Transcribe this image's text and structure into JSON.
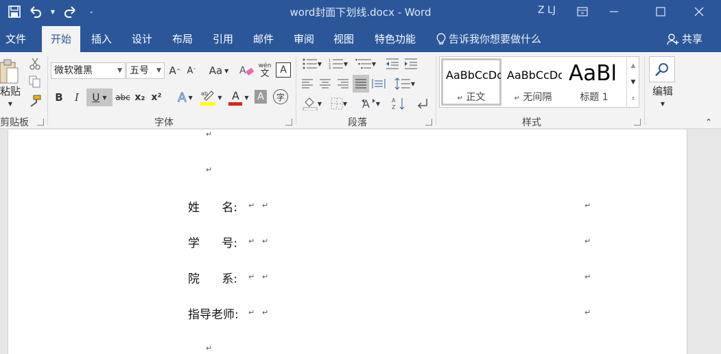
{
  "window": {
    "title": "word封面下划线.docx  -  Word",
    "user": "Z LJ"
  },
  "tabs": [
    "文件",
    "开始",
    "插入",
    "设计",
    "布局",
    "引用",
    "邮件",
    "审阅",
    "视图",
    "特色功能"
  ],
  "active_tab": "开始",
  "tellme": "告诉我你想要做什么",
  "share": "共享",
  "clipboard": {
    "paste": "粘贴",
    "label": "剪贴板"
  },
  "font": {
    "name": "微软雅黑",
    "size": "五号",
    "label": "字体",
    "bold": "B",
    "italic": "I",
    "underline": "U",
    "strike": "abc",
    "sub": "x₂",
    "sup": "x²",
    "grow": "A",
    "shrink": "A",
    "case": "Aa",
    "phonetic_top": "wén",
    "phonetic_bottom": "文",
    "border": "A",
    "effect": "A",
    "color_a": "A",
    "shade_a": "A",
    "enclose": "字",
    "highlight_color": "#ffff00",
    "font_color": "#e02020"
  },
  "paragraph": {
    "label": "段落"
  },
  "styles": {
    "label": "样式",
    "items": [
      {
        "sample": "AaBbCcDc",
        "name": "正文",
        "mark": "↵"
      },
      {
        "sample": "AaBbCcDc",
        "name": "无间隔",
        "mark": "↵"
      },
      {
        "sample": "AaBl",
        "name": "标题 1"
      }
    ]
  },
  "editing": {
    "label": "编辑"
  },
  "document": {
    "mark": "↵",
    "fields": [
      {
        "label": "姓      名:"
      },
      {
        "label": "学      号:"
      },
      {
        "label": "院      系:"
      },
      {
        "label": "指导老师:"
      }
    ]
  },
  "colors": {
    "title_bar": "#2b579a",
    "ribbon_bg": "#f3f3f3",
    "page_bg": "#ffffff",
    "canvas_bg": "#e6e6e6"
  }
}
